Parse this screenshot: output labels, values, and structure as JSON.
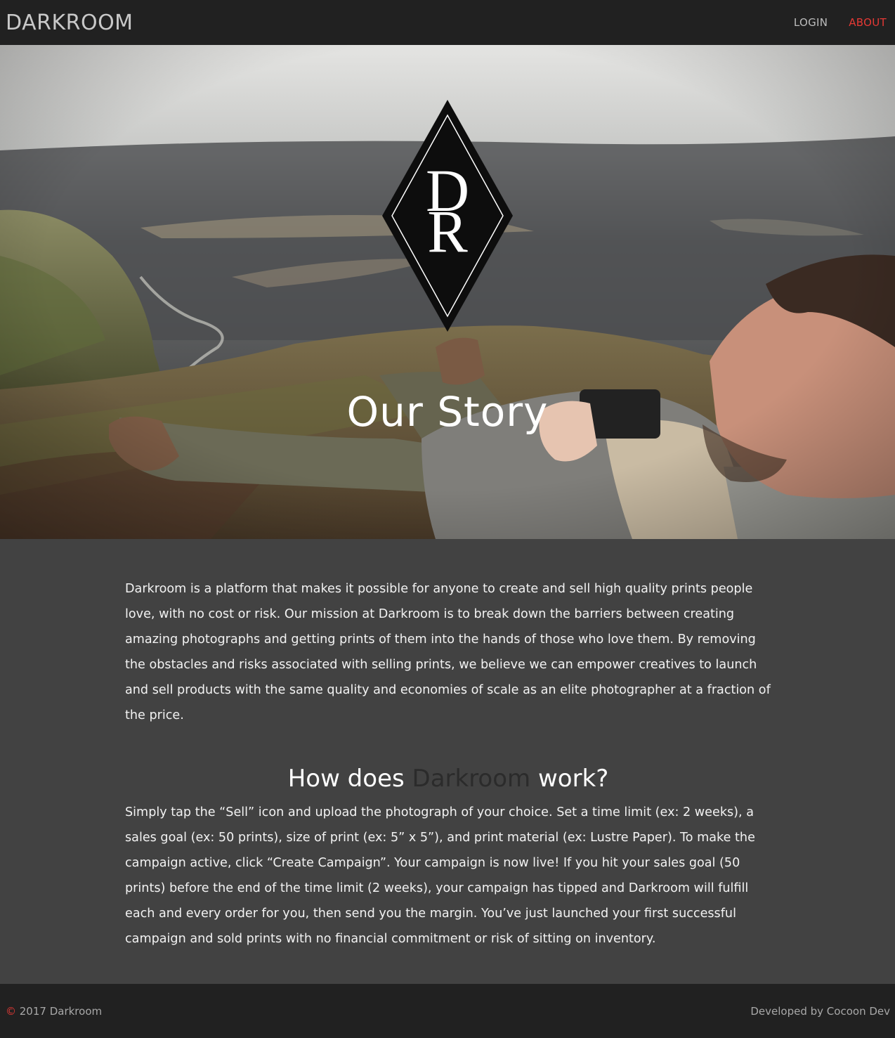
{
  "nav": {
    "brand": "DARKROOM",
    "links": [
      {
        "label": "LOGIN",
        "active": false
      },
      {
        "label": "ABOUT",
        "active": true
      }
    ],
    "accent_color": "#e53935"
  },
  "hero": {
    "logo_letter": "R",
    "logo_letter_top": "D",
    "title": "Our Story"
  },
  "content": {
    "intro": "Darkroom is a platform that makes it possible for anyone to create and sell high quality prints people love, with no cost or risk. Our mission at Darkroom is to break down the barriers between creating amazing photographs and getting prints of them into the hands of those who love them. By removing the obstacles and risks associated with selling prints, we believe we can empower creatives to launch and sell products with the same quality and economies of scale as an elite photographer at a fraction of the price.",
    "heading_pre": "How does ",
    "heading_brand": "Darkroom",
    "heading_post": " work?",
    "how_it_works": "Simply tap the “Sell” icon and upload the photograph of your choice. Set a time limit (ex: 2 weeks), a sales goal (ex: 50 prints), size of print (ex: 5” x 5”), and print material (ex: Lustre Paper). To make the campaign active, click “Create Campaign”. Your campaign is now live! If you hit your sales goal (50 prints) before the end of the time limit (2 weeks), your campaign has tipped and Darkroom will fulfill each and every order for you, then send you the margin. You’ve just launched your first successful campaign and sold prints with no financial commitment or risk of sitting on inventory."
  },
  "footer": {
    "copyright_symbol": "©",
    "copyright_text": " 2017 Darkroom",
    "credit": "Developed by Cocoon Dev"
  }
}
